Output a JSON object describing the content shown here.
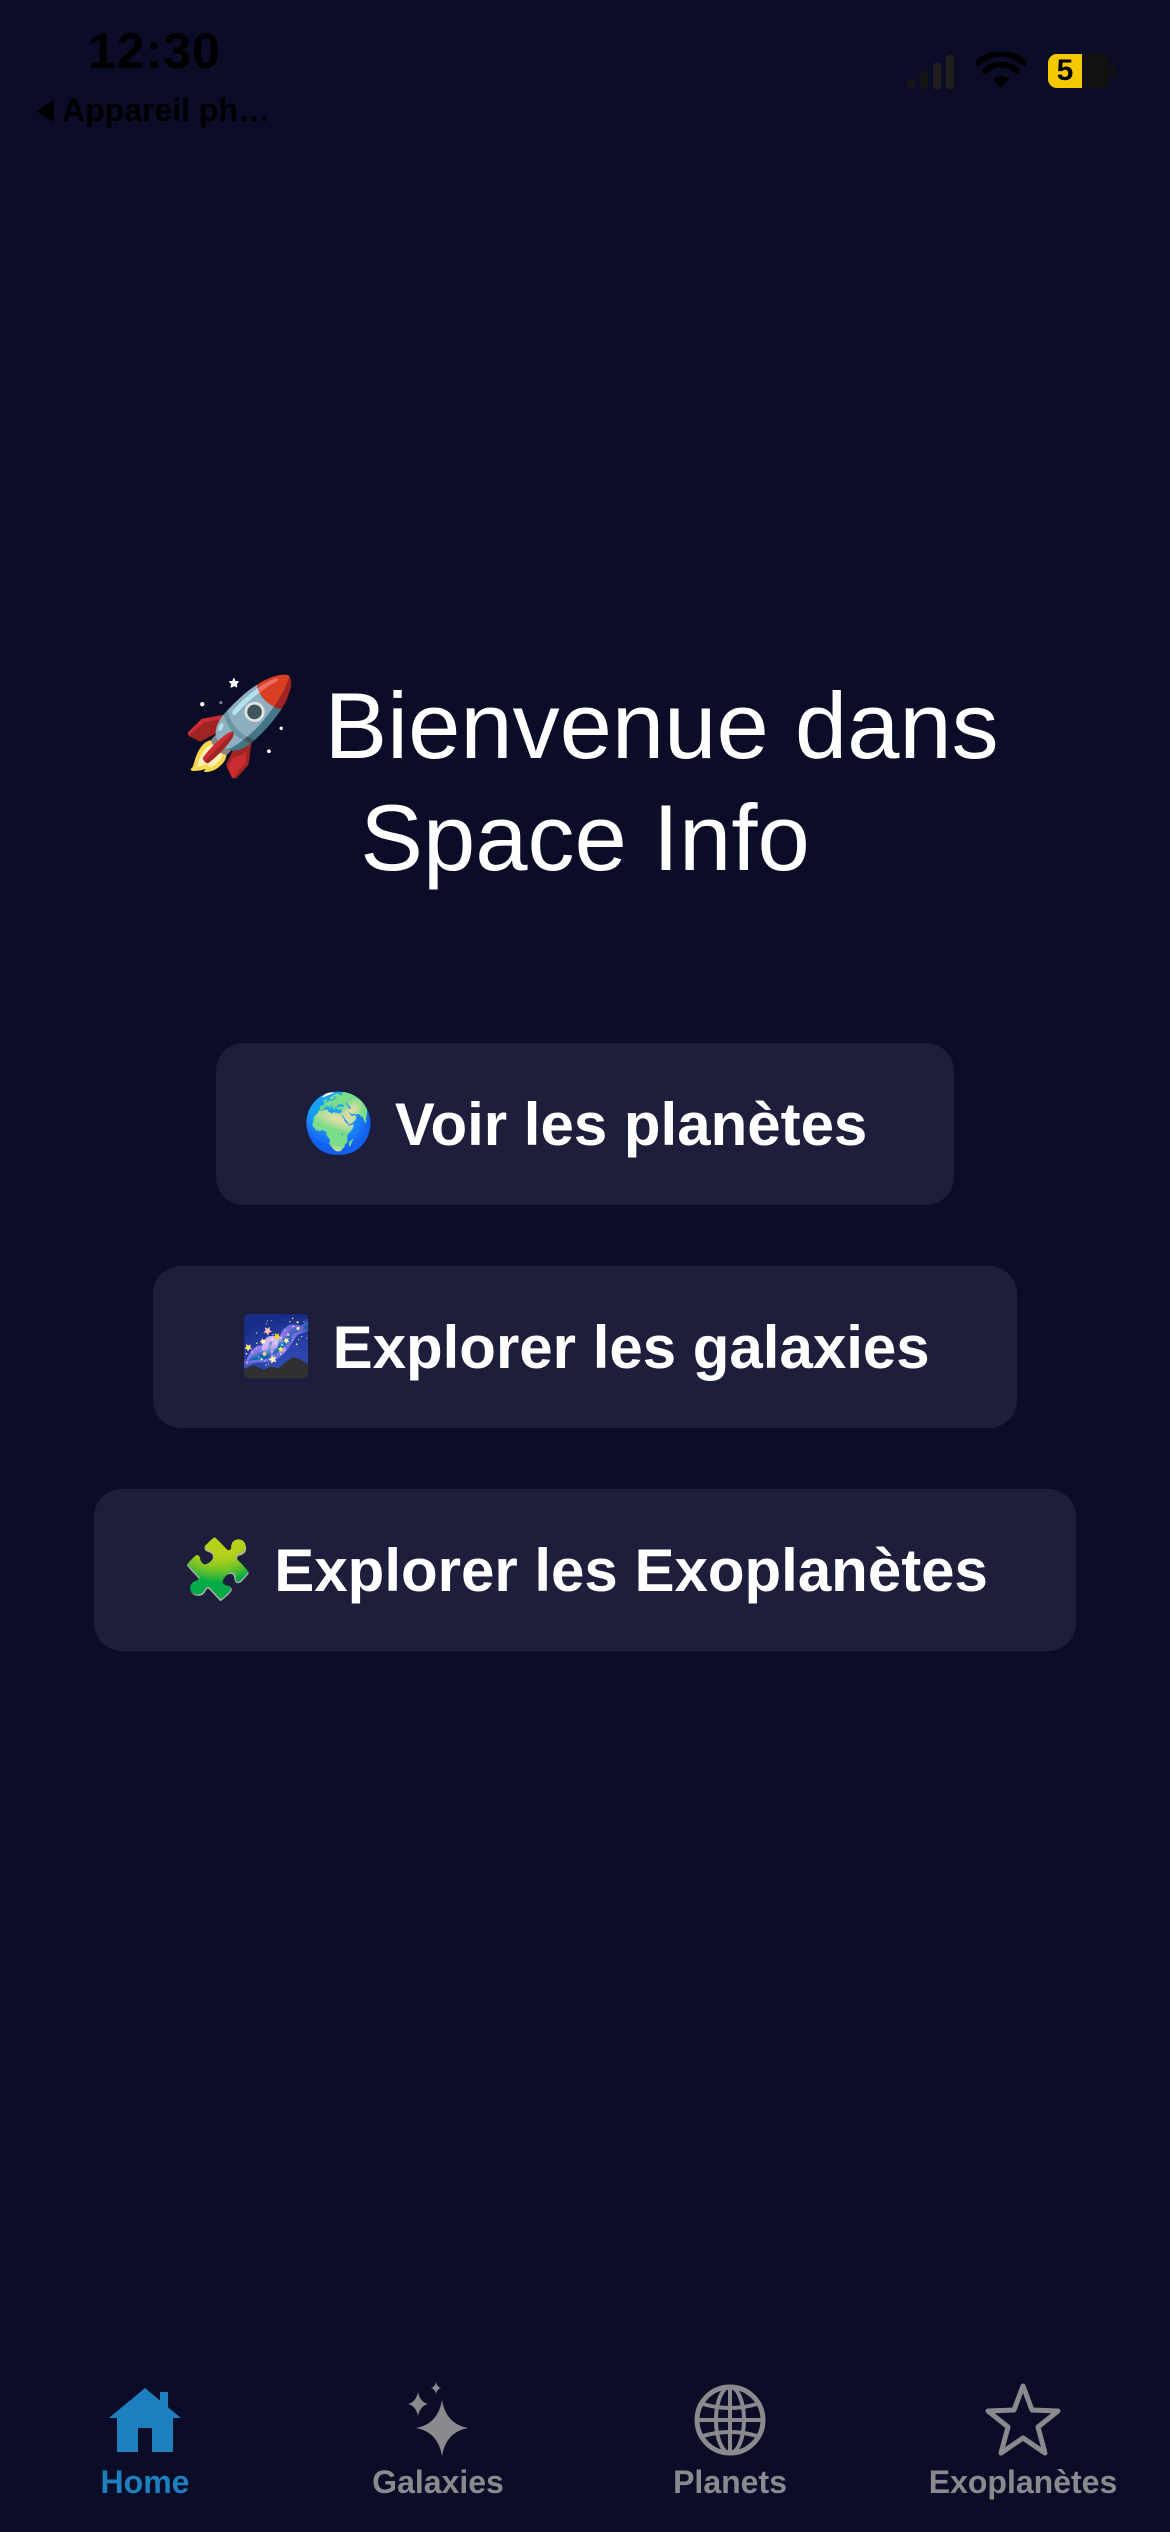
{
  "status_bar": {
    "time": "12:30",
    "back_label": "Appareil ph…",
    "battery_level": "5"
  },
  "title": {
    "line1_emoji": "🚀",
    "line1": "Bienvenue dans",
    "line2": "Space Info"
  },
  "menu": {
    "planets": {
      "emoji": "🌍",
      "label": "Voir les planètes"
    },
    "galaxies": {
      "emoji": "🌌",
      "label": "Explorer les galaxies"
    },
    "exoplanets": {
      "emoji": "🧩",
      "label": "Explorer les Exoplanètes"
    }
  },
  "tabbar": {
    "items": [
      {
        "label": "Home",
        "icon": "house-icon",
        "active": true
      },
      {
        "label": "Galaxies",
        "icon": "sparkles-icon",
        "active": false
      },
      {
        "label": "Planets",
        "icon": "globe-icon",
        "active": false
      },
      {
        "label": "Exoplanètes",
        "icon": "star-icon",
        "active": false
      }
    ]
  },
  "colors": {
    "background": "#0b0c28",
    "button_bg": "#1d1e3c",
    "tab_active": "#1e7fbf",
    "tab_inactive": "#8a8a8e"
  }
}
